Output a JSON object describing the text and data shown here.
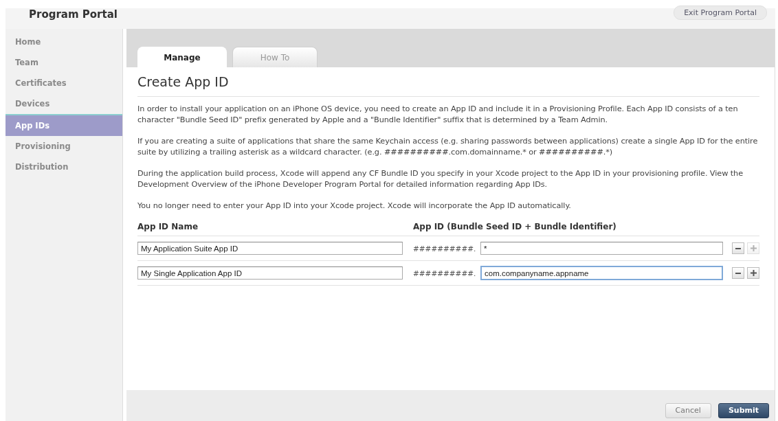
{
  "header": {
    "title": "Program Portal",
    "exit_button": "Exit Program Portal"
  },
  "sidebar": {
    "items": [
      {
        "label": "Home",
        "selected": false
      },
      {
        "label": "Team",
        "selected": false
      },
      {
        "label": "Certificates",
        "selected": false
      },
      {
        "label": "Devices",
        "selected": false
      },
      {
        "label": "App IDs",
        "selected": true
      },
      {
        "label": "Provisioning",
        "selected": false
      },
      {
        "label": "Distribution",
        "selected": false
      }
    ]
  },
  "tabs": [
    {
      "label": "Manage",
      "selected": true
    },
    {
      "label": "How To",
      "selected": false
    }
  ],
  "heading": "Create App ID",
  "paragraphs": [
    "In order to install your application on an iPhone OS device, you need to create an App ID and include it in a Provisioning Profile. Each App ID consists of a ten character \"Bundle Seed ID\" prefix generated by Apple and a \"Bundle Identifier\" suffix that is determined by a Team Admin.",
    "If you are creating a suite of applications that share the same Keychain access (e.g. sharing passwords between applications) create a single App ID for the entire suite by utilizing a trailing asterisk as a wildcard character. (e.g.  ##########.com.domainname.* or ##########.*)",
    "During the application build process, Xcode will append any CF Bundle ID you specify in your Xcode project to the App ID in your provisioning profile. View the Development Overview of the iPhone Developer Program Portal for detailed information regarding App IDs.",
    "You no longer need to enter your App ID into your Xcode project.  Xcode will incorporate the App ID automatically."
  ],
  "form": {
    "columns": [
      "App ID Name",
      "App ID (Bundle Seed ID + Bundle Identifier)"
    ],
    "rows": [
      {
        "name": "My Application Suite App ID",
        "prefix": "##########.",
        "identifier": "*",
        "focused": false,
        "add_disabled": true
      },
      {
        "name": "My Single Application App ID",
        "prefix": "##########.",
        "identifier": "com.companyname.appname",
        "focused": true,
        "add_disabled": false
      }
    ]
  },
  "buttons": {
    "cancel": "Cancel",
    "submit": "Submit"
  }
}
